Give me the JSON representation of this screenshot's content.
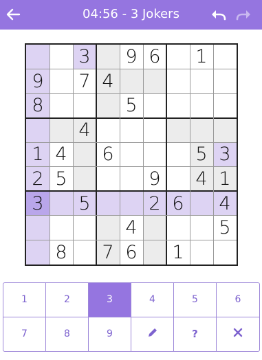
{
  "header": {
    "title": "04:56 - 3 Jokers",
    "back_icon": "arrow-left-icon",
    "undo_icon": "undo-icon",
    "redo_icon": "redo-icon"
  },
  "colors": {
    "accent": "#9575e0",
    "band_highlight": "#ececec",
    "value_highlight": "#ddd3f3",
    "selected_cell": "#b9a6ea",
    "digit": "#111111"
  },
  "board": {
    "selected_digit": "3",
    "rows": [
      [
        "",
        "",
        "3",
        "",
        "9",
        "6",
        "",
        "1",
        ""
      ],
      [
        "9",
        "",
        "7",
        "4",
        "",
        "",
        "",
        "",
        ""
      ],
      [
        "8",
        "",
        "",
        "",
        "5",
        "",
        "",
        "",
        ""
      ],
      [
        "",
        "",
        "4",
        "",
        "",
        "",
        "",
        "",
        ""
      ],
      [
        "1",
        "4",
        "",
        "6",
        "",
        "",
        "",
        "5",
        "3"
      ],
      [
        "2",
        "5",
        "",
        "",
        "",
        "9",
        "",
        "4",
        "1"
      ],
      [
        "3",
        "",
        "5",
        "",
        "",
        "2",
        "6",
        "",
        "4"
      ],
      [
        "",
        "",
        "",
        "",
        "4",
        "",
        "",
        "",
        "5"
      ],
      [
        "",
        "8",
        "",
        "7",
        "6",
        "",
        "1",
        "",
        ""
      ]
    ],
    "highlight": [
      [
        "v",
        "",
        "v",
        "b",
        "",
        "",
        "",
        "",
        ""
      ],
      [
        "v",
        "",
        "",
        "b",
        "b",
        "b",
        "",
        "",
        ""
      ],
      [
        "v",
        "",
        "",
        "b",
        "",
        "",
        "",
        "",
        ""
      ],
      [
        "v",
        "b",
        "b",
        "",
        "",
        "",
        "b",
        "b",
        "b"
      ],
      [
        "v",
        "",
        "b",
        "",
        "",
        "",
        "",
        "b",
        "v"
      ],
      [
        "v",
        "",
        "b",
        "",
        "",
        "",
        "",
        "b",
        "b"
      ],
      [
        "s",
        "r",
        "r",
        "r",
        "r",
        "r",
        "r",
        "r",
        "r"
      ],
      [
        "v",
        "",
        "",
        "b",
        "",
        "b",
        "",
        "",
        ""
      ],
      [
        "v",
        "",
        "",
        "b",
        "",
        "b",
        "",
        "",
        ""
      ]
    ]
  },
  "keypad": {
    "row1": [
      "1",
      "2",
      "3",
      "4",
      "5",
      "6"
    ],
    "row2": [
      "7",
      "8",
      "9"
    ],
    "active": "3",
    "tools": [
      "pencil-icon",
      "hint-question-icon",
      "erase-x-icon"
    ],
    "hint_label": "?"
  }
}
